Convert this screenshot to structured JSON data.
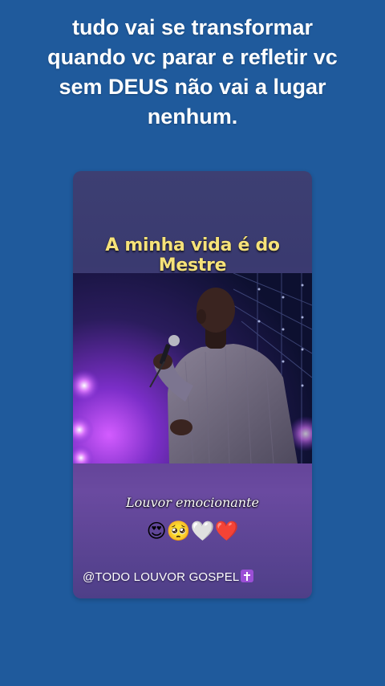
{
  "caption": {
    "text": "tudo vai se transformar quando vc parar e refletir vc sem DEUS não vai a lugar nenhum."
  },
  "video": {
    "overlay_title": "A minha vida é do Mestre",
    "subtitle": "Louvor emocionante",
    "emojis": "😍🥺🤍❤️",
    "credit": "@TODO LOUVOR GOSPEL",
    "credit_icon": "latin-cross-icon"
  },
  "colors": {
    "background": "#1f5a9c",
    "overlay_title": "#f6e27a",
    "cross_icon_bg": "#9b4fd6"
  }
}
